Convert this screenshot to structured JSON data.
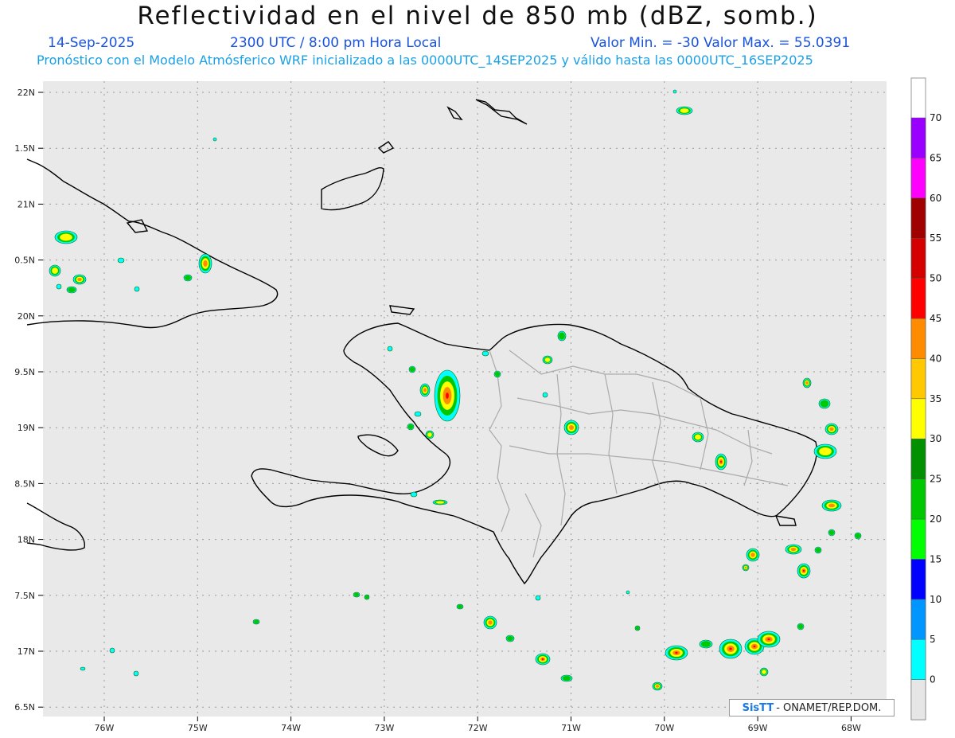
{
  "header": {
    "title": "Reflectividad en el nivel de 850 mb (dBZ, somb.)",
    "date": "14-Sep-2025",
    "time": "2300 UTC / 8:00 pm Hora Local",
    "min_max": "Valor Min. = -30  Valor Max. = 55.0391",
    "forecast": "Pronóstico con el Modelo Atmósferico WRF inicializado a las 0000UTC_14SEP2025 y válido hasta las  0000UTC_16SEP2025"
  },
  "axes": {
    "lat_labels": [
      "22N",
      "1.5N",
      "21N",
      "0.5N",
      "20N",
      "9.5N",
      "19N",
      "8.5N",
      "18N",
      "7.5N",
      "17N",
      "6.5N"
    ],
    "lon_labels": [
      "76W",
      "75W",
      "74W",
      "73W",
      "72W",
      "71W",
      "70W",
      "69W",
      "68W"
    ]
  },
  "colorbar": {
    "labels": [
      "0",
      "5",
      "10",
      "15",
      "20",
      "25",
      "30",
      "35",
      "40",
      "45",
      "50",
      "55",
      "60",
      "65",
      "70"
    ],
    "colors": [
      "#e6e6e6",
      "#00ffff",
      "#0096ff",
      "#0000ff",
      "#00ff00",
      "#00c800",
      "#009000",
      "#ffff00",
      "#ffc800",
      "#ff8c00",
      "#ff0000",
      "#d40000",
      "#a00000",
      "#ff00ff",
      "#9a00ff"
    ]
  },
  "credit": {
    "logo": "SisTT",
    "text": "- ONAMET/REP.DOM."
  }
}
